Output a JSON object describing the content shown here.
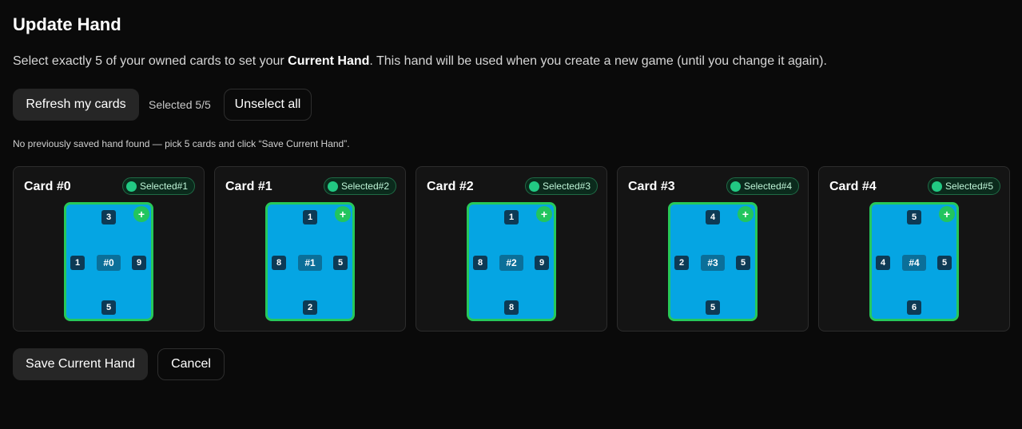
{
  "header": {
    "title": "Update Hand"
  },
  "intro": {
    "before": "Select exactly 5 of your owned cards to set your ",
    "strong": "Current Hand",
    "after": ". This hand will be used when you create a new game (until you change it again)."
  },
  "toolbar": {
    "refresh_label": "Refresh my cards",
    "selected_text": "Selected 5/5",
    "unselect_label": "Unselect all"
  },
  "notice": "No previously saved hand found — pick 5 cards and click “Save Current Hand”.",
  "cards": [
    {
      "title": "Card #0",
      "badge": "Selected#1",
      "top": "3",
      "left": "1",
      "center": "#0",
      "right": "9",
      "bottom": "5",
      "plus": "+"
    },
    {
      "title": "Card #1",
      "badge": "Selected#2",
      "top": "1",
      "left": "8",
      "center": "#1",
      "right": "5",
      "bottom": "2",
      "plus": "+"
    },
    {
      "title": "Card #2",
      "badge": "Selected#3",
      "top": "1",
      "left": "8",
      "center": "#2",
      "right": "9",
      "bottom": "8",
      "plus": "+"
    },
    {
      "title": "Card #3",
      "badge": "Selected#4",
      "top": "4",
      "left": "2",
      "center": "#3",
      "right": "5",
      "bottom": "5",
      "plus": "+"
    },
    {
      "title": "Card #4",
      "badge": "Selected#5",
      "top": "5",
      "left": "4",
      "center": "#4",
      "right": "5",
      "bottom": "6",
      "plus": "+"
    }
  ],
  "actions": {
    "save_label": "Save Current Hand",
    "cancel_label": "Cancel"
  },
  "colors": {
    "background": "#0a0a0a",
    "card_face": "#05a5e3",
    "selected_border": "#27c85a",
    "badge_dot": "#22c983"
  },
  "icons": {
    "badge_indicator": "status-dot-icon",
    "add": "plus-icon"
  }
}
